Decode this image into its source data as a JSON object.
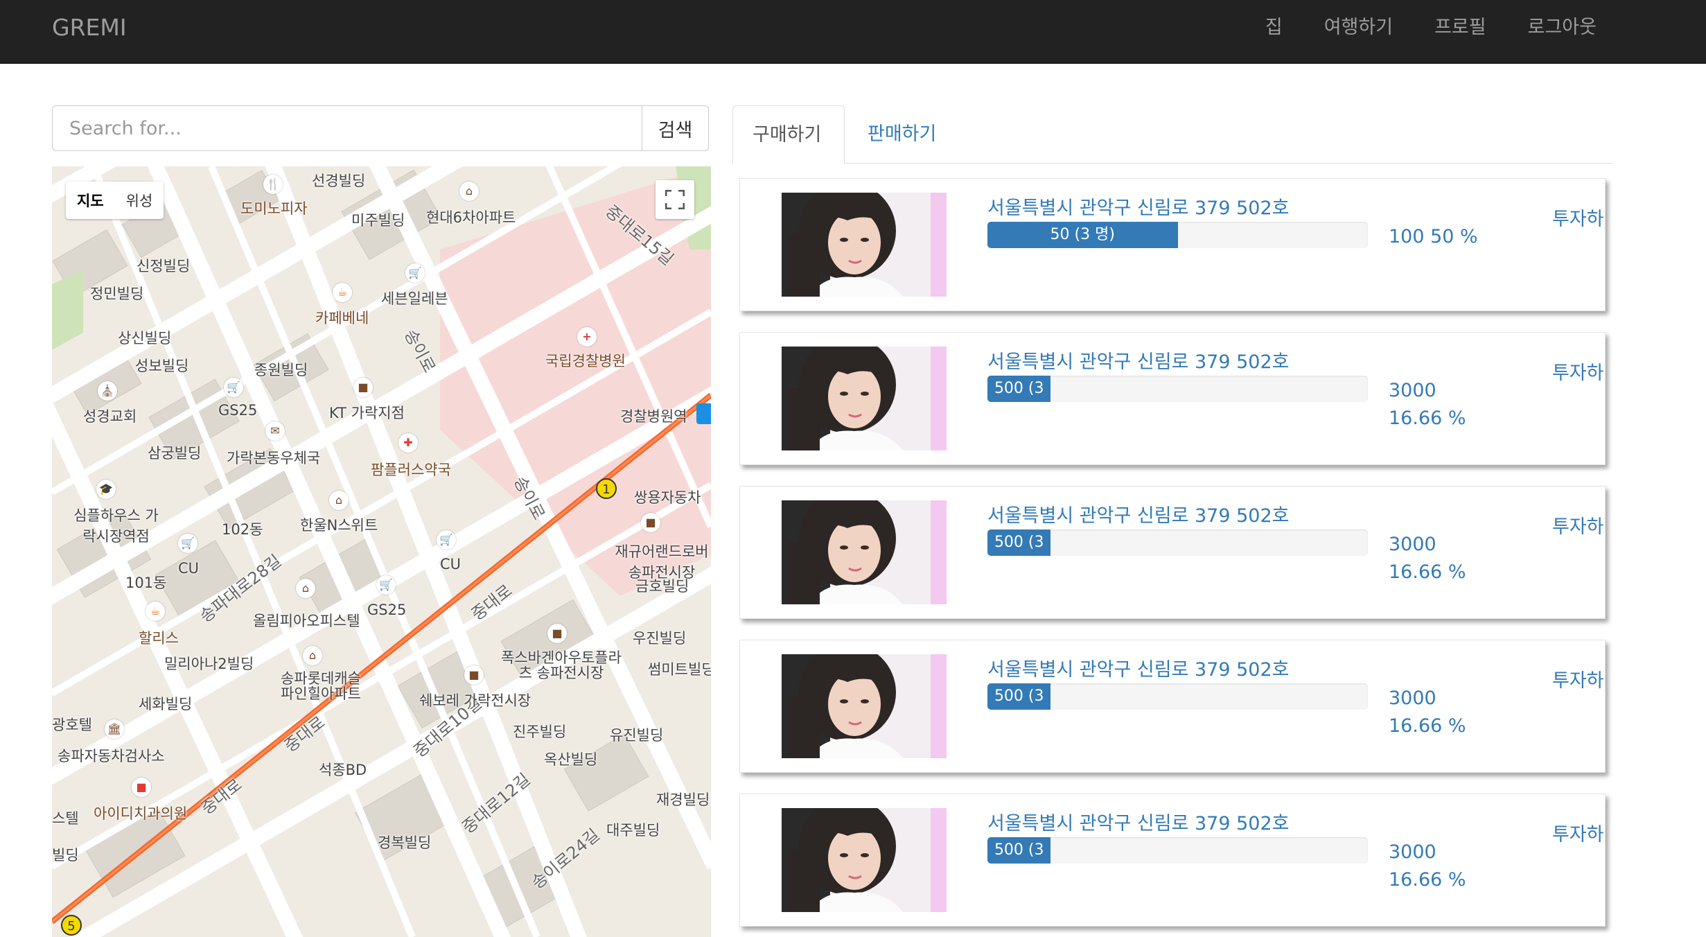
{
  "navbar": {
    "brand": "GREMI",
    "links": [
      "집",
      "여행하기",
      "프로필",
      "로그아웃"
    ]
  },
  "search": {
    "placeholder": "Search for...",
    "button": "검색"
  },
  "map": {
    "type_buttons": [
      "지도",
      "위성"
    ],
    "road_labels": [
      "송이로",
      "송이로",
      "중대로",
      "중대로",
      "중대로",
      "송파대로28길",
      "중대로10길",
      "중대로12길",
      "송이로24길",
      "중대로15길"
    ],
    "place_labels": [
      "선경빌딩",
      "도미노피자",
      "미주빌딩",
      "현대6차아파트",
      "신정빌딩",
      "정민빌딩",
      "세븐일레븐",
      "카페베네",
      "상신빌딩",
      "성보빌딩",
      "종원빌딩",
      "국립경찰병원",
      "성경교회",
      "GS25",
      "KT 가락지점",
      "경찰병원역",
      "삼궁빌딩",
      "가락본동우체국",
      "팜플러스약국",
      "쌍용자동차",
      "심플하우스 가락시장역점",
      "102동",
      "한울N스위트",
      "재규어랜드로버 송파전시장",
      "CU",
      "101동",
      "CU",
      "금호빌딩",
      "올림피아오피스텔",
      "GS25",
      "할리스",
      "우진빌딩",
      "밀리아나2빌딩",
      "송파롯데캐슬 파인힐아파트",
      "폭스바겐아우토플라츠 송파전시장",
      "썸미트빌딩",
      "세화빌딩",
      "쉐보레 가락전시장",
      "진주빌딩",
      "유진빌딩",
      "광호텔",
      "송파자동차검사소",
      "옥산빌딩",
      "석종BD",
      "재경빌딩",
      "아이디치과의원",
      "스텔",
      "대주빌딩",
      "빌딩",
      "경복빌딩"
    ]
  },
  "tabs": {
    "buy": "구매하기",
    "sell": "판매하기"
  },
  "listings": [
    {
      "address": "서울특별시 관악구 신림로 379 502호",
      "bar_label": "50 (3 명)",
      "progress_pct": 50,
      "amount": "100 50 %",
      "percent": "",
      "invest": "투자하기"
    },
    {
      "address": "서울특별시 관악구 신림로 379 502호",
      "bar_label": "500 (3",
      "progress_pct": 16.66,
      "amount": "3000",
      "percent": "16.66 %",
      "invest": "투자하기"
    },
    {
      "address": "서울특별시 관악구 신림로 379 502호",
      "bar_label": "500 (3",
      "progress_pct": 16.66,
      "amount": "3000",
      "percent": "16.66 %",
      "invest": "투자하기"
    },
    {
      "address": "서울특별시 관악구 신림로 379 502호",
      "bar_label": "500 (3",
      "progress_pct": 16.66,
      "amount": "3000",
      "percent": "16.66 %",
      "invest": "투자하기"
    },
    {
      "address": "서울특별시 관악구 신림로 379 502호",
      "bar_label": "500 (3",
      "progress_pct": 16.66,
      "amount": "3000",
      "percent": "16.66 %",
      "invest": "투자하기"
    }
  ],
  "colors": {
    "navbar": "#222222",
    "link": "#337ab7",
    "progress": "#337ab7",
    "road": "#f26a32"
  }
}
